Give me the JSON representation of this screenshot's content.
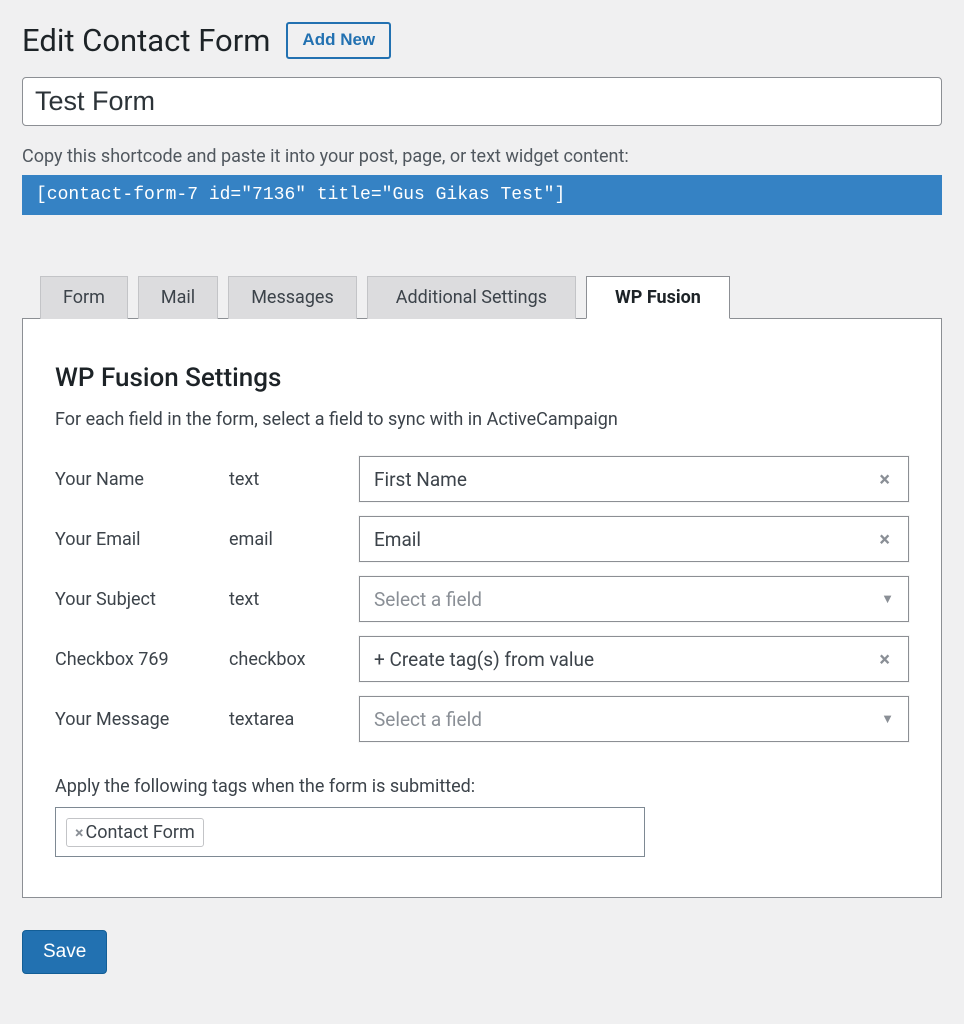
{
  "header": {
    "title": "Edit Contact Form",
    "add_new": "Add New"
  },
  "form_title": "Test Form",
  "shortcode_hint": "Copy this shortcode and paste it into your post, page, or text widget content:",
  "shortcode": "[contact-form-7 id=\"7136\" title=\"Gus Gikas Test\"]",
  "tabs": [
    "Form",
    "Mail",
    "Messages",
    "Additional Settings",
    "WP Fusion"
  ],
  "active_tab": "WP Fusion",
  "panel": {
    "title": "WP Fusion Settings",
    "desc": "For each field in the form, select a field to sync with in ActiveCampaign",
    "placeholder": "Select a field",
    "rows": [
      {
        "label": "Your Name",
        "type": "text",
        "value": "First Name",
        "has_value": true
      },
      {
        "label": "Your Email",
        "type": "email",
        "value": "Email",
        "has_value": true
      },
      {
        "label": "Your Subject",
        "type": "text",
        "value": "",
        "has_value": false
      },
      {
        "label": "Checkbox 769",
        "type": "checkbox",
        "value": "+ Create tag(s) from value",
        "has_value": true
      },
      {
        "label": "Your Message",
        "type": "textarea",
        "value": "",
        "has_value": false
      }
    ],
    "tags_label": "Apply the following tags when the form is submitted:",
    "tags": [
      "Contact Form"
    ]
  },
  "save_label": "Save"
}
